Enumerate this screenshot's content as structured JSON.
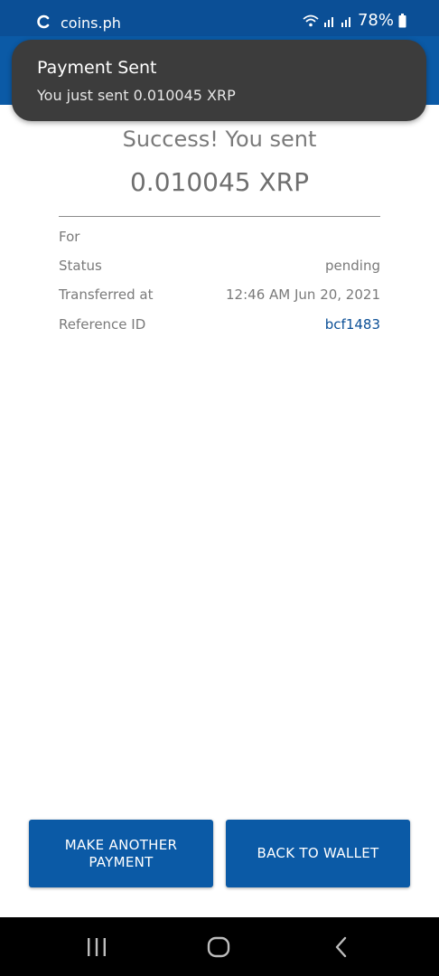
{
  "status_bar": {
    "app_name": "coins.ph",
    "battery_text": "78%",
    "icons": [
      "wifi-icon",
      "signal-icon",
      "signal-icon",
      "battery-icon"
    ]
  },
  "notification": {
    "title": "Payment Sent",
    "message": "You just sent 0.010045 XRP"
  },
  "receipt": {
    "success_text": "Success! You sent",
    "amount": "0.010045 XRP",
    "rows": [
      {
        "label": "For",
        "value": ""
      },
      {
        "label": "Status",
        "value": "pending"
      },
      {
        "label": "Transferred at",
        "value": "12:46 AM Jun 20, 2021"
      },
      {
        "label": "Reference ID",
        "value": "bcf1483"
      }
    ]
  },
  "actions": {
    "make_another_label": "MAKE ANOTHER PAYMENT",
    "back_to_wallet_label": "BACK TO WALLET"
  },
  "colors": {
    "brand_blue": "#0b5aa6",
    "status_blue": "#0b4f96",
    "toast_bg": "#3c3c3c",
    "link": "#0b4f96"
  },
  "nav": {
    "icons": [
      "recent-apps-icon",
      "home-icon",
      "back-icon"
    ]
  }
}
